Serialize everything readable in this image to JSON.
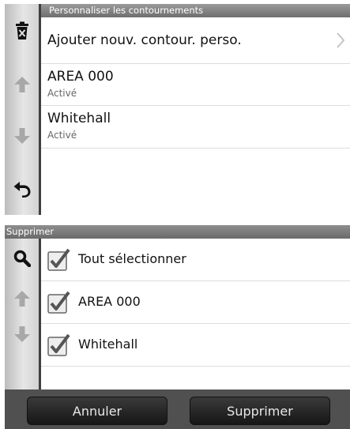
{
  "screen1": {
    "header": "Personnaliser les contournements",
    "sidebar": {
      "top_icon": "trash-icon",
      "up_icon": "arrow-up-icon",
      "down_icon": "arrow-down-icon",
      "back_icon": "back-arrow-icon"
    },
    "items": [
      {
        "title": "Ajouter nouv. contour. perso.",
        "icon": "chevron-right-icon"
      },
      {
        "title": "AREA 000",
        "subtitle": "Activé"
      },
      {
        "title": "Whitehall",
        "subtitle": "Activé"
      }
    ]
  },
  "screen2": {
    "header": "Supprimer",
    "sidebar": {
      "top_icon": "search-icon",
      "up_icon": "arrow-up-icon",
      "down_icon": "arrow-down-icon"
    },
    "items": [
      {
        "label": "Tout sélectionner",
        "checked": true
      },
      {
        "label": "AREA 000",
        "checked": true
      },
      {
        "label": "Whitehall",
        "checked": true
      }
    ],
    "buttons": {
      "cancel": "Annuler",
      "delete": "Supprimer"
    }
  },
  "colors": {
    "header_bg": "#7f7f7f",
    "footer_bg": "#505050",
    "button_bg": "#222222",
    "arrow_disabled": "#a8a8a8",
    "text": "#111111",
    "subtext": "#666666"
  }
}
